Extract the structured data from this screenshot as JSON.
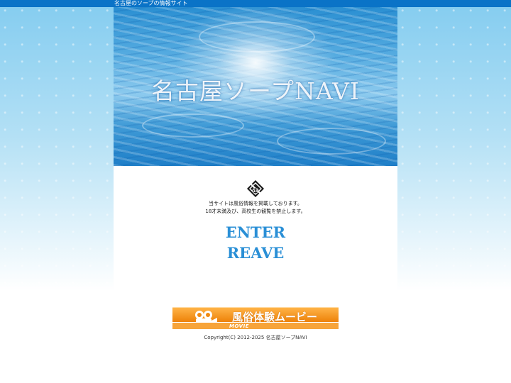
{
  "header": {
    "tagline": "名古屋のソープの情報サイト"
  },
  "hero": {
    "site_title": "名古屋ソープNAVI"
  },
  "age_gate": {
    "icon": "age-18-restriction-icon",
    "badge_text": "18",
    "notice_line1": "当サイトは風俗情報を掲載しております。",
    "notice_line2": "18才未満及び、高校生の観覧を禁止します。",
    "enter_label": "ENTER",
    "leave_label": "REAVE"
  },
  "banner": {
    "title": "風俗体験ムービー",
    "subtitle": "MOVIE",
    "icon": "movie-camera-icon"
  },
  "footer": {
    "copyright": "Copyright(C) 2012-2025 名古屋ソープNAVI"
  },
  "colors": {
    "topbar": "#0a73c7",
    "link_blue": "#2a8fd6",
    "banner_orange": "#f08a13"
  }
}
